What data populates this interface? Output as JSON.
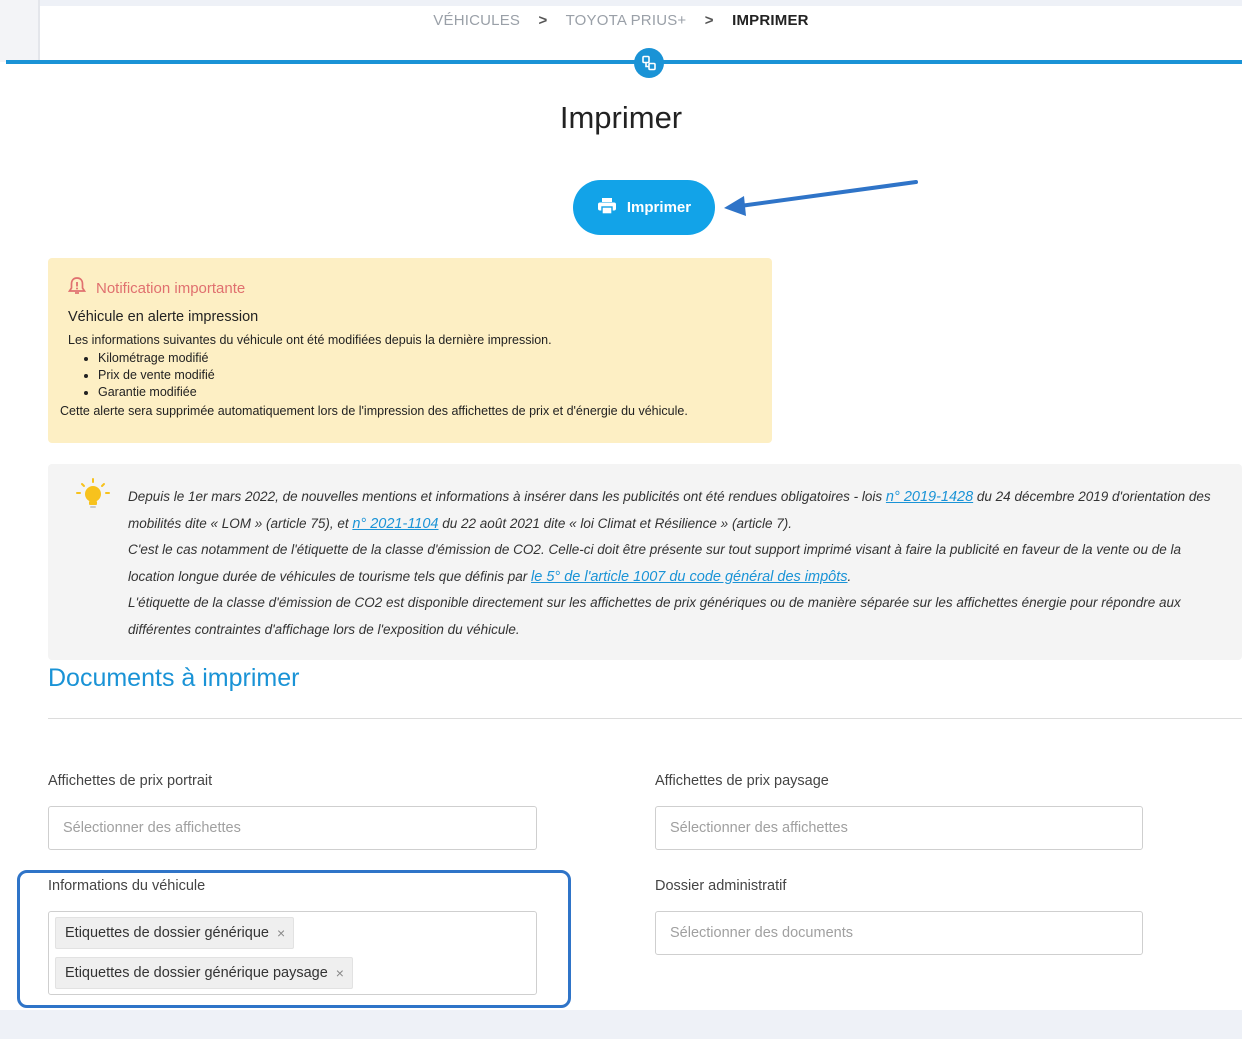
{
  "breadcrumb": {
    "items": [
      "VÉHICULES",
      "TOYOTA PRIUS+"
    ],
    "separator": ">",
    "current": "IMPRIMER"
  },
  "step_icon": "document-step-icon",
  "page_title": "Imprimer",
  "print_button": {
    "label": "Imprimer",
    "icon": "printer-icon",
    "color": "#12a3e8"
  },
  "notification": {
    "title": "Notification importante",
    "icon": "bell-alert-icon",
    "subtitle": "Véhicule en alerte impression",
    "intro": "Les informations suivantes du véhicule ont été modifiées depuis la dernière impression.",
    "items": [
      "Kilométrage modifié",
      "Prix de vente modifié",
      "Garantie modifiée"
    ],
    "footer": "Cette alerte sera supprimée automatiquement lors de l'impression des affichettes de prix et d'énergie du véhicule."
  },
  "info": {
    "icon": "lightbulb-icon",
    "p1_a": "Depuis le 1er mars 2022, de nouvelles mentions et informations à insérer dans les publicités ont été rendues obligatoires - lois ",
    "link1": "n° 2019-1428",
    "p1_b": " du 24 décembre 2019 d'orientation des mobilités dite « LOM » (article 75), et ",
    "link2": "n° 2021-1104",
    "p1_c": " du 22 août 2021 dite « loi Climat et Résilience » (article 7).",
    "p2_a": "C'est le cas notamment de l'étiquette de la classe d'émission de CO2. Celle-ci doit être présente sur tout support imprimé visant à faire la publicité en faveur de la vente ou de la location longue durée de véhicules de tourisme tels que définis par ",
    "link3": "le 5° de l'article 1007 du code général des impôts",
    "p2_b": ".",
    "p3": "L'étiquette de la classe d'émission de CO2 est disponible directement sur les affichettes de prix génériques ou de manière séparée sur les affichettes énergie pour répondre aux différentes contraintes d'affichage lors de l'exposition du véhicule."
  },
  "documents": {
    "heading": "Documents à imprimer",
    "portrait": {
      "label": "Affichettes de prix portrait",
      "placeholder": "Sélectionner des affichettes"
    },
    "paysage": {
      "label": "Affichettes de prix paysage",
      "placeholder": "Sélectionner des affichettes"
    },
    "vehicule": {
      "label": "Informations du véhicule",
      "tags": [
        "Etiquettes de dossier générique",
        "Etiquettes de dossier générique paysage"
      ],
      "remove_glyph": "×"
    },
    "admin": {
      "label": "Dossier administratif",
      "placeholder": "Sélectionner des documents"
    }
  },
  "colors": {
    "accent": "#1a93d6",
    "notification_bg": "#fdefc4",
    "annotation": "#2f74c8"
  }
}
